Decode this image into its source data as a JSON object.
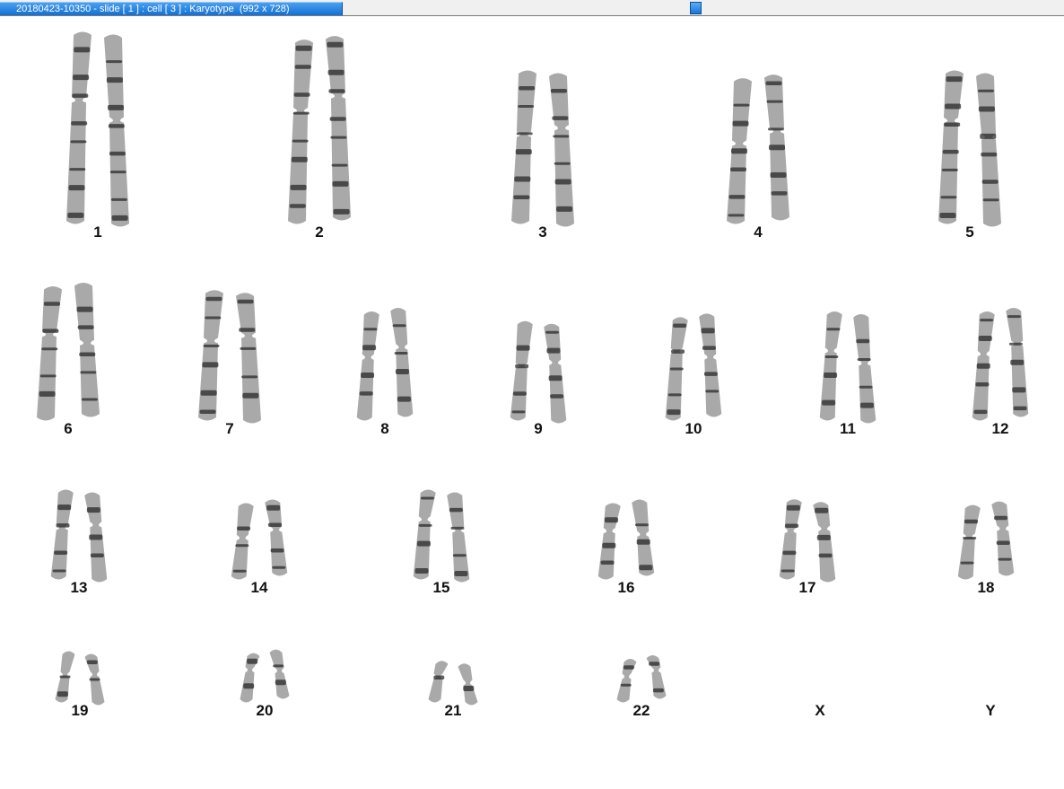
{
  "window": {
    "title": "20180423-10350 - slide [ 1 ] : cell [ 3 ] : Karyotype  (992 x 728)"
  },
  "colors": {
    "chromosome_dark": "#2a2a2a",
    "chromosome_light": "#9a9a9a",
    "title_tab": "#1270d6"
  },
  "karyotype": {
    "chromosomes": [
      {
        "label": "1",
        "length": 1.0,
        "present": true
      },
      {
        "label": "2",
        "length": 0.96,
        "present": true
      },
      {
        "label": "3",
        "length": 0.8,
        "present": true
      },
      {
        "label": "4",
        "length": 0.76,
        "present": true
      },
      {
        "label": "5",
        "length": 0.8,
        "present": true
      },
      {
        "label": "6",
        "length": 0.7,
        "present": true
      },
      {
        "label": "7",
        "length": 0.68,
        "present": true
      },
      {
        "label": "8",
        "length": 0.57,
        "present": true
      },
      {
        "label": "9",
        "length": 0.52,
        "present": true
      },
      {
        "label": "10",
        "length": 0.54,
        "present": true
      },
      {
        "label": "11",
        "length": 0.57,
        "present": true
      },
      {
        "label": "12",
        "length": 0.57,
        "present": true
      },
      {
        "label": "13",
        "length": 0.47,
        "present": true
      },
      {
        "label": "14",
        "length": 0.4,
        "present": true
      },
      {
        "label": "15",
        "length": 0.47,
        "present": true
      },
      {
        "label": "16",
        "length": 0.4,
        "present": true
      },
      {
        "label": "17",
        "length": 0.42,
        "present": true
      },
      {
        "label": "18",
        "length": 0.39,
        "present": true
      },
      {
        "label": "19",
        "length": 0.27,
        "present": true
      },
      {
        "label": "20",
        "length": 0.26,
        "present": true
      },
      {
        "label": "21",
        "length": 0.22,
        "present": true
      },
      {
        "label": "22",
        "length": 0.23,
        "present": true
      },
      {
        "label": "X",
        "length": 0.0,
        "present": false
      },
      {
        "label": "Y",
        "length": 0.0,
        "present": false
      }
    ]
  }
}
